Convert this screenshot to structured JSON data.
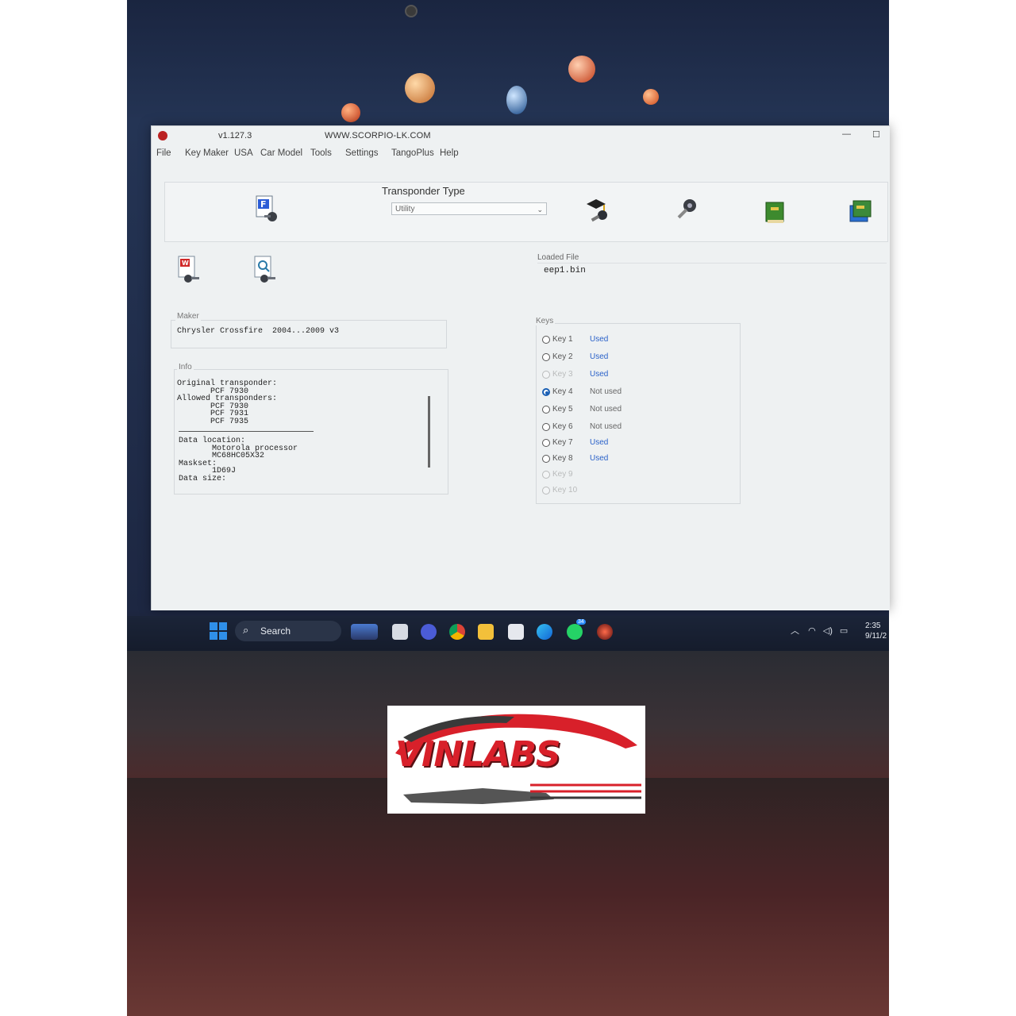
{
  "window": {
    "version": "v1.127.3",
    "url": "WWW.SCORPIO-LK.COM",
    "controls": [
      "—",
      "☐"
    ]
  },
  "menu": [
    "File",
    "Key Maker",
    "USA",
    "Car Model",
    "Tools",
    "Settings",
    "TangoPlus",
    "Help"
  ],
  "toolbar": {
    "transponder_type_label": "Transponder Type",
    "transponder_type_value": "Utility",
    "icons": [
      "file-f-icon",
      "key-cap-icon",
      "key-tool-icon",
      "green-book-icon",
      "blue-book-icon"
    ]
  },
  "file_buttons": [
    "write-file-icon",
    "search-file-icon"
  ],
  "loaded_file": {
    "label": "Loaded File",
    "value": "eep1.bin"
  },
  "maker": {
    "label": "Maker",
    "value": "Chrysler Crossfire  2004...2009 v3"
  },
  "info": {
    "label": "Info",
    "block1": "Original transponder:\n       PCF 7930\nAllowed transponders:\n       PCF 7930\n       PCF 7931\n       PCF 7935",
    "block2": "Data location:\n       Motorola processor\n       MC68HC05X32\nMaskset:\n       1D69J\nData size:"
  },
  "keys": {
    "label": "Keys",
    "items": [
      {
        "label": "Key 1",
        "status": "Used"
      },
      {
        "label": "Key 2",
        "status": "Used"
      },
      {
        "label": "Key 3",
        "status": "Used"
      },
      {
        "label": "Key 4",
        "status": "Not used"
      },
      {
        "label": "Key 5",
        "status": "Not used"
      },
      {
        "label": "Key 6",
        "status": "Not used"
      },
      {
        "label": "Key 7",
        "status": "Used"
      },
      {
        "label": "Key 8",
        "status": "Used"
      },
      {
        "label": "Key 9",
        "status": ""
      },
      {
        "label": "Key 10",
        "status": ""
      }
    ],
    "selected": "Key 4"
  },
  "taskbar": {
    "search_label": "Search",
    "time": "2:35",
    "date": "9/11/2",
    "badge": "34"
  },
  "logo": {
    "text": "VINLABS",
    "colors": {
      "red": "#d8202a",
      "dark": "#3a3a3a"
    }
  }
}
